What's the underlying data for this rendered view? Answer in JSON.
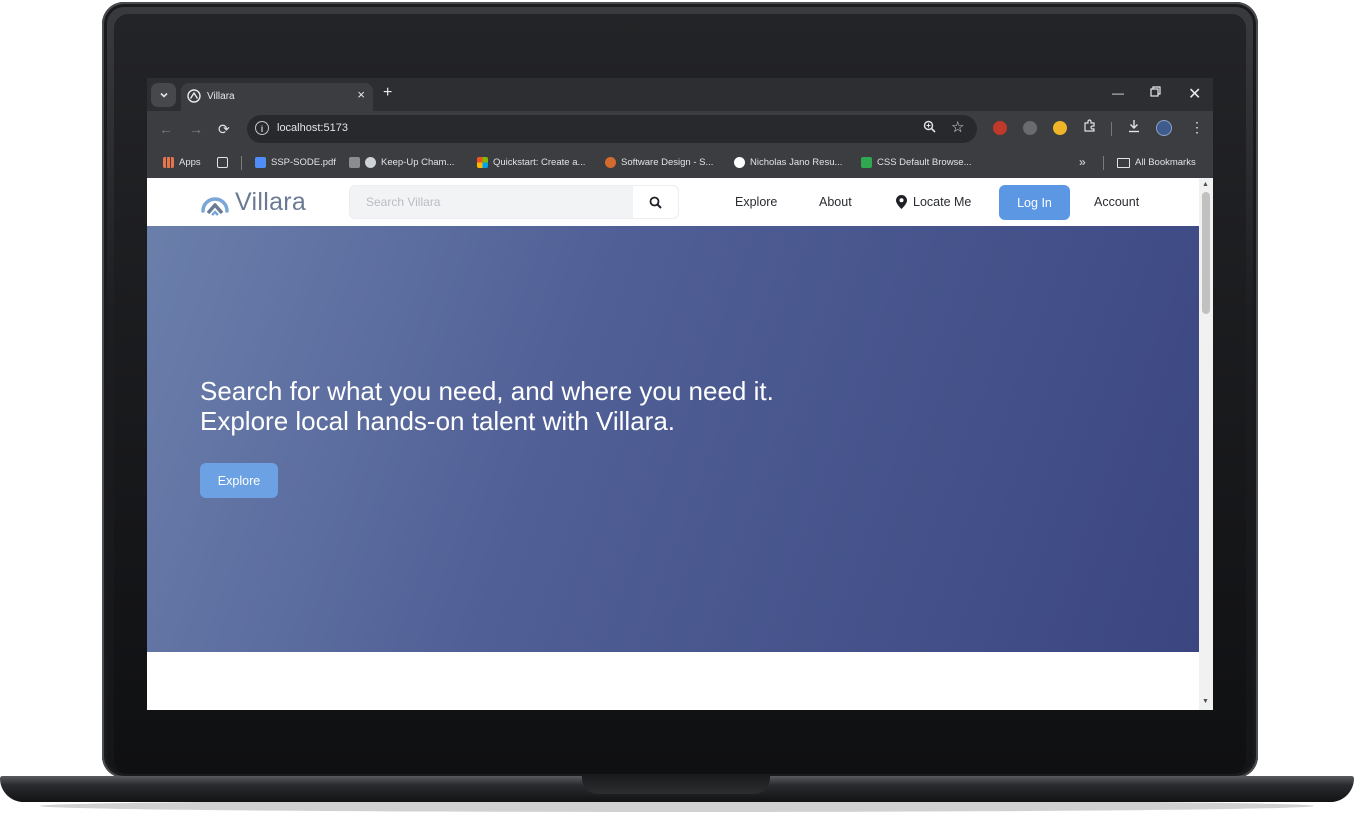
{
  "browser": {
    "tab_title": "Villara",
    "new_tab_label": "+",
    "url": "localhost:5173",
    "bookmarks": [
      {
        "label": "Apps",
        "color": "#e8744b"
      },
      {
        "label": "SSP-SODE.pdf",
        "color": "#4f8ef7"
      },
      {
        "label": "Keep-Up Cham...",
        "color": "#cfd2d6"
      },
      {
        "label": "Quickstart: Create a...",
        "color": "#f25022"
      },
      {
        "label": "Software Design - S...",
        "color": "#d36a2e"
      },
      {
        "label": "Nicholas Jano Resu...",
        "color": "#ffffff"
      },
      {
        "label": "CSS Default Browse...",
        "color": "#2fa84f"
      }
    ],
    "all_bookmarks_label": "All Bookmarks"
  },
  "site": {
    "logo_text": "Villara",
    "search_placeholder": "Search Villara",
    "nav": {
      "explore": "Explore",
      "about": "About",
      "locate": "Locate Me",
      "login": "Log In",
      "account": "Account"
    },
    "hero": {
      "line1": "Search for what you need, and where you need it.",
      "line2": "Explore local hands-on talent with Villara.",
      "button": "Explore"
    }
  },
  "colors": {
    "brand_blue": "#5b97e3",
    "hero_start": "#6b7fab",
    "hero_end": "#3b4680"
  }
}
